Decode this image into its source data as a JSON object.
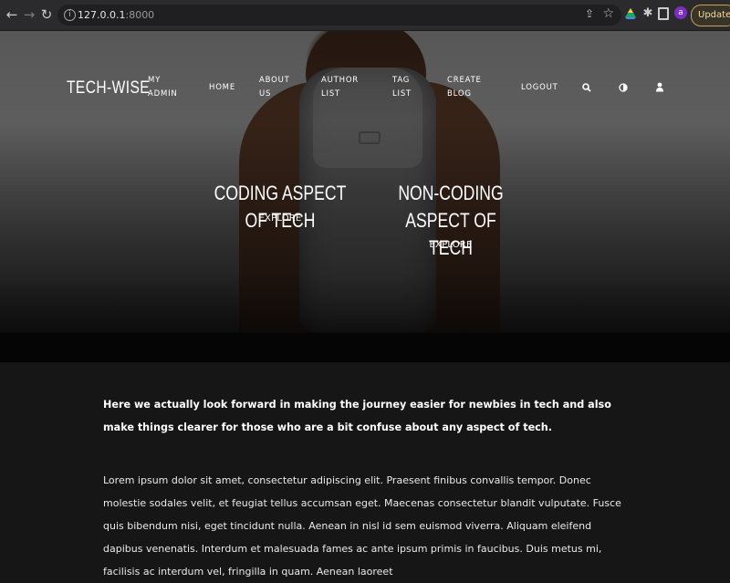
{
  "browser": {
    "url_host": "127.0.0.1",
    "url_port": ":8000",
    "avatar_letter": "a",
    "update_label": "Update"
  },
  "site": {
    "brand": "TECH-WISE",
    "nav": {
      "my_admin": [
        "MY",
        "ADMIN"
      ],
      "home": "HOME",
      "about_us": [
        "ABOUT",
        "US"
      ],
      "author_list": [
        "AUTHOR",
        "LIST"
      ],
      "tag_list": [
        "TAG",
        "LIST"
      ],
      "create_blog": [
        "CREATE",
        "BLOG"
      ],
      "logout": "LOGOUT"
    },
    "icons": [
      "search-icon",
      "theme-toggle-icon",
      "user-icon"
    ]
  },
  "hero": {
    "cards": [
      {
        "title": "CODING ASPECT OF TECH",
        "link": "EXPLORE"
      },
      {
        "title_lines": [
          "NON-CODING ASPECT OF",
          "TECH"
        ],
        "link": "EXPLORE"
      }
    ]
  },
  "content": {
    "intro": "Here we actually look forward in making the journey easier for newbies in tech and also make things clearer for those who are a bit confuse about any aspect of tech.",
    "lorem": "Lorem ipsum dolor sit amet, consectetur adipiscing elit. Praesent finibus convallis tempor. Donec molestie sodales velit, et feugiat tellus accumsan eget. Maecenas consectetur blandit vulputate. Fusce quis bibendum nisi, eget tincidunt nulla. Aenean in nisl id sem euismod viverra. Aliquam eleifend dapibus venenatis. Interdum et malesuada fames ac ante ipsum primis in faucibus. Duis metus mi, facilisis ac interdum vel, fringilla in quam. Aenean laoreet"
  }
}
